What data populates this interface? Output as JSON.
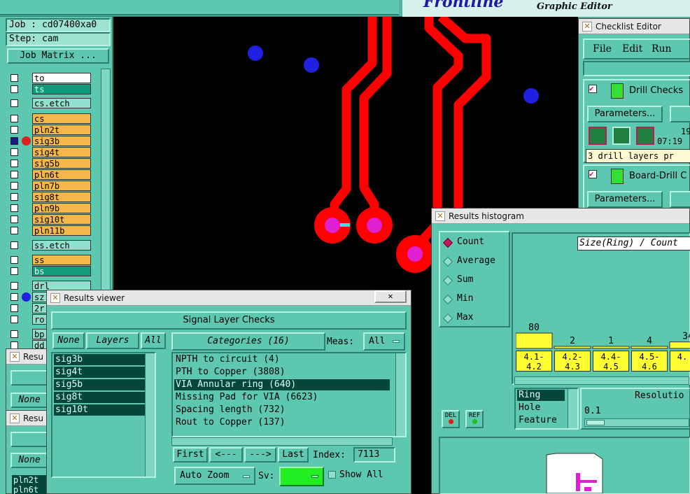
{
  "top_strip": {
    "logo_text": "Frontline",
    "subtitle": "Graphic Editor"
  },
  "job_panel": {
    "job": "Job : cd07400xa0",
    "step": "Step: cam",
    "job_matrix_button": "Job Matrix ..."
  },
  "layers": [
    {
      "name": "to",
      "style": "white"
    },
    {
      "name": "ts",
      "style": "green"
    },
    {
      "name": "cs.etch",
      "style": "teal"
    },
    {
      "name": "cs",
      "style": "orange"
    },
    {
      "name": "pln2t",
      "style": "orange"
    },
    {
      "name": "sig3b",
      "style": "orange"
    },
    {
      "name": "sig4t",
      "style": "orange"
    },
    {
      "name": "sig5b",
      "style": "orange"
    },
    {
      "name": "pln6t",
      "style": "orange"
    },
    {
      "name": "pln7b",
      "style": "orange"
    },
    {
      "name": "sig8t",
      "style": "orange"
    },
    {
      "name": "pln9b",
      "style": "orange"
    },
    {
      "name": "sig10t",
      "style": "orange"
    },
    {
      "name": "pln11b",
      "style": "orange"
    },
    {
      "name": "ss.etch",
      "style": "teal"
    },
    {
      "name": "ss",
      "style": "orange"
    },
    {
      "name": "bs",
      "style": "green"
    },
    {
      "name": "drl",
      "style": "teal"
    },
    {
      "name": "sz",
      "style": "teal"
    },
    {
      "name": "2r",
      "style": "teal"
    },
    {
      "name": "ro",
      "style": "teal"
    },
    {
      "name": "bp",
      "style": "teal"
    },
    {
      "name": "dd",
      "style": "teal"
    }
  ],
  "checklist_editor": {
    "title": "Checklist Editor",
    "menu": [
      "File",
      "Edit",
      "Run"
    ],
    "check1": {
      "name": "Drill Checks",
      "params": "Parameters...",
      "date": "19",
      "time": "07:19",
      "status": "3 drill layers pr"
    },
    "check2": {
      "name": "Board-Drill C",
      "params": "Parameters..."
    }
  },
  "results_viewer": {
    "title": "Results viewer",
    "heading": "Signal Layer Checks",
    "none_button": "None",
    "layers_label": "Layers",
    "all_button": "All",
    "layers": [
      "sig3b",
      "sig4t",
      "sig5b",
      "sig8t",
      "sig10t"
    ],
    "categories_label": "Categories (16)",
    "meas_label": "Meas:",
    "meas_value": "All",
    "categories": [
      {
        "label": "NPTH to circuit (4)",
        "selected": false
      },
      {
        "label": "PTH to Copper (3808)",
        "selected": false
      },
      {
        "label": "VIA Annular ring (640)",
        "selected": true
      },
      {
        "label": "Missing Pad for VIA (6623)",
        "selected": false
      },
      {
        "label": "Spacing length (732)",
        "selected": false
      },
      {
        "label": "Rout to Copper (137)",
        "selected": false
      }
    ],
    "nav": {
      "first": "First",
      "prev": "<---",
      "next": "--->",
      "last": "Last",
      "index_label": "Index:",
      "index_value": "7113"
    },
    "auto_zoom": "Auto Zoom",
    "sv_label": "Sv:",
    "show_all": "Show All"
  },
  "histogram": {
    "title": "Results histogram",
    "modes": [
      {
        "label": "Count",
        "on": true
      },
      {
        "label": "Average",
        "on": false
      },
      {
        "label": "Sum",
        "on": false
      },
      {
        "label": "Min",
        "on": false
      },
      {
        "label": "Max",
        "on": false
      }
    ],
    "chart_title": "Size(Ring) / Count",
    "chart_data": {
      "type": "bar",
      "categories": [
        "4.1-4.2",
        "4.2-4.3",
        "4.4-4.5",
        "4.5-4.6",
        "4."
      ],
      "values": [
        80,
        2,
        1,
        4,
        34
      ],
      "value_labels": [
        "80",
        "2",
        "1",
        "4",
        "34"
      ]
    },
    "criteria": [
      "Ring",
      "Hole",
      "Feature"
    ],
    "resolution_label": "Resolutio",
    "resolution_value": "0.1",
    "del_label": "DEL",
    "ref_label": "REF"
  },
  "bottom_left_windows": {
    "res1": "Resu",
    "res2": "Resu",
    "none1": "None",
    "none2": "None",
    "layer1": "pln2t",
    "layer2": "pln6t"
  },
  "colors": {
    "trace": "#ff0000",
    "pad_center": "#e020d0",
    "via": "#2020e0",
    "canvas": "#000000",
    "panel": "#5ec7b0"
  }
}
